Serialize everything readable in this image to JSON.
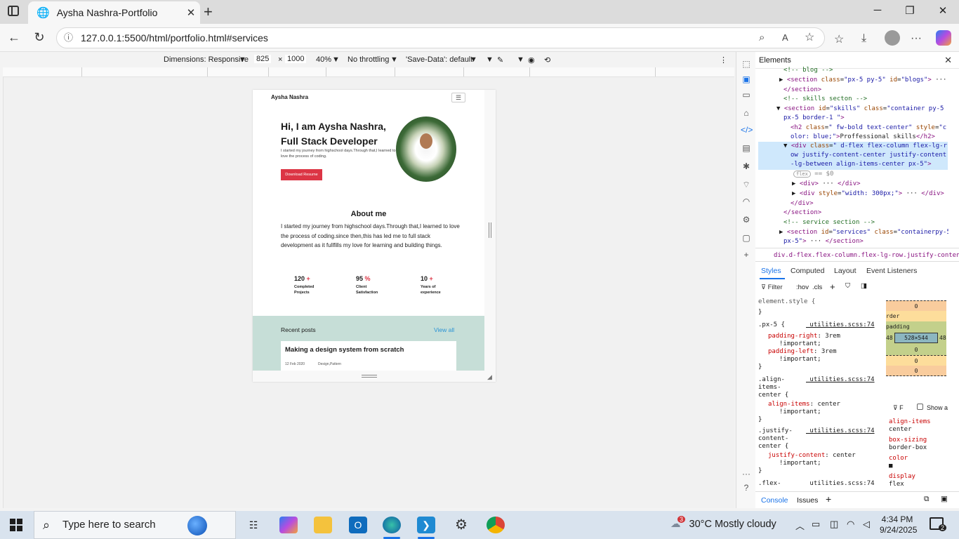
{
  "browser": {
    "tab_title": "Aysha Nashra-Portfolio",
    "url": "127.0.0.1:5500/html/portfolio.html#services"
  },
  "device_toolbar": {
    "dimensions": "Dimensions: Responsive",
    "width": "825",
    "times": "×",
    "height": "1000",
    "zoom": "40%",
    "throttling": "No throttling",
    "save_data": "'Save-Data': default"
  },
  "site": {
    "brand": "Aysha Nashra",
    "hero_line1": "Hi, I am Aysha Nashra,",
    "hero_line2": "Full Stack Developer",
    "hero_text": "I started my journey from highschool days.Through that,I learned to love the process of coding.",
    "download_btn": "Download Resume",
    "about_heading": "About me",
    "about_text": "I started my journey from highschool days.Through that,I learned to love the process of coding.since then,this has led me to full stack development as it fullfills my love for learning and building things.",
    "stats": [
      {
        "num": "120",
        "suffix": "+",
        "label": "Completed Projects"
      },
      {
        "num": "95",
        "suffix": "%",
        "label": "Client Satisfaction"
      },
      {
        "num": "10",
        "suffix": "+",
        "label": "Years of experience"
      }
    ],
    "recent_posts": "Recent posts",
    "view_all": "View all",
    "post_title": "Making a design system from scratch",
    "post_date": "12 Feb 2020",
    "post_tags": "Design,Pattern"
  },
  "devtools": {
    "panel_title": "Elements",
    "breadcrumb": "div.d-flex.flex-column.flex-lg-row.justify-content-center.ju",
    "style_tabs": [
      "Styles",
      "Computed",
      "Layout",
      "Event Listeners"
    ],
    "filter": "Filter",
    "hov": ":hov",
    "cls": ".cls",
    "box_size": "528×544",
    "box_zero": "0",
    "box_padding_label": "padding",
    "box_padding_side": "48",
    "box_border_label": "rder",
    "show_all": "Show a",
    "computed_filter": "F",
    "computed": [
      {
        "prop": "align-items",
        "val": "center"
      },
      {
        "prop": "box-sizing",
        "val": "border-box"
      },
      {
        "prop": "color",
        "val": "■"
      },
      {
        "prop": "display",
        "val": "flex"
      }
    ],
    "bottom_tabs": [
      "Console",
      "Issues"
    ]
  },
  "taskbar": {
    "search_placeholder": "Type here to search",
    "weather": "30°C  Mostly cloudy",
    "weather_badge": "3",
    "time": "4:34 PM",
    "date": "9/24/2025",
    "notifications": "2"
  }
}
